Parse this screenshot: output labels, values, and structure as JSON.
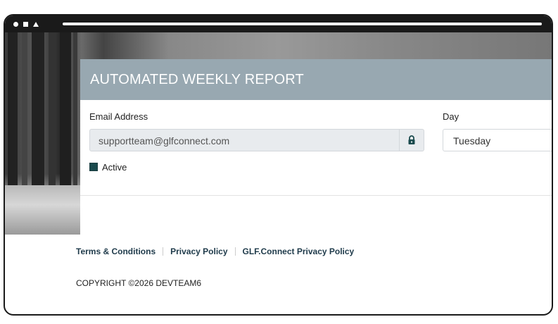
{
  "card": {
    "title": "AUTOMATED WEEKLY REPORT",
    "email_label": "Email Address",
    "email_value": "supportteam@glfconnect.com",
    "day_label": "Day",
    "day_value": "Tuesday",
    "active_label": "Active",
    "active_checked": true
  },
  "footer": {
    "links": [
      "Terms & Conditions",
      "Privacy Policy",
      "GLF.Connect Privacy Policy"
    ],
    "copyright": "COPYRIGHT ©2026 DEVTEAM6"
  },
  "colors": {
    "header_bg": "#98a8b1",
    "accent": "#1a4a4d",
    "link": "#1e3a4a"
  },
  "icons": [
    "lock-icon"
  ]
}
